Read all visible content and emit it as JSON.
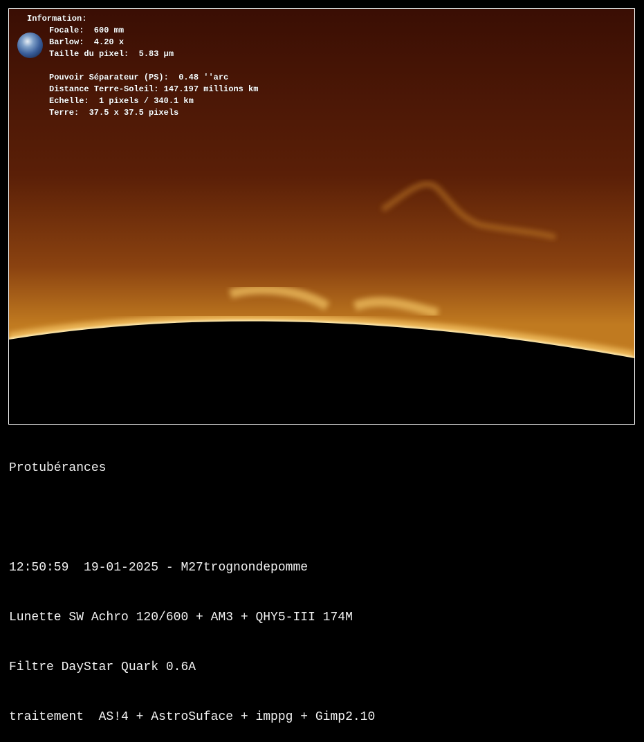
{
  "info": {
    "heading": "Information:",
    "lines_top": [
      "Focale:  600 mm",
      "Barlow:  4.20 x",
      "Taille du pixel:  5.83 µm"
    ],
    "lines_bottom": [
      "Pouvoir Séparateur (PS):  0.48 ''arc",
      "Distance Terre-Soleil: 147.197 millions km",
      "Echelle:  1 pixels / 340.1 km",
      "Terre:  37.5 x 37.5 pixels"
    ]
  },
  "caption": {
    "title": "Protubérances",
    "lines": [
      "12:50:59  19-01-2025 - M27trognondepomme",
      "Lunette SW Achro 120/600 + AM3 + QHY5-III 174M",
      "Filtre DayStar Quark 0.6A",
      "traitement  AS!4 + AstroSuface + imppg + Gimp2.10"
    ]
  }
}
